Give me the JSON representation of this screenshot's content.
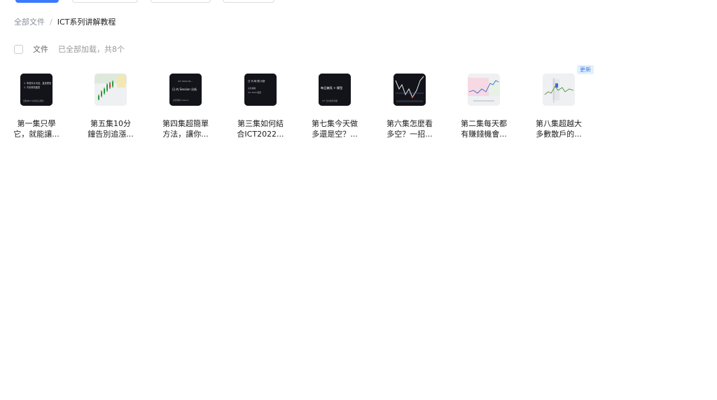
{
  "breadcrumb": {
    "root": "全部文件",
    "separator": "/",
    "current": "ICT系列讲解教程"
  },
  "list_header": {
    "column_label": "文件",
    "status": "已全部加载，共8个"
  },
  "files": [
    {
      "name_line1": "第一集只學",
      "name_line2": "它，就能讓...",
      "thumb_style": "dark-text",
      "thumb_text": [
        "1. 學習本片內容，直接實操",
        "2. 不用再看圖表",
        "掌握本ICT交易核心概念"
      ]
    },
    {
      "name_line1": "第五集10分",
      "name_line2": "鐘告別追漲...",
      "thumb_style": "light-chart"
    },
    {
      "name_line1": "第四集超簡單",
      "name_line2": "方法，讓你...",
      "thumb_style": "dark-text",
      "thumb_text": [
        "ICT 2022 Mo…",
        "日 內 Session 分析",
        "交易時段 Session"
      ]
    },
    {
      "name_line1": "第三集如何結",
      "name_line2": "合ICT2022...",
      "thumb_style": "dark-text",
      "thumb_text": [
        "日 內 時 間 分析",
        "交易策略",
        "ICT 2022 模型"
      ]
    },
    {
      "name_line1": "第七集今天做",
      "name_line2": "多還是空？...",
      "thumb_style": "dark-text",
      "thumb_text": [
        "每日偏見 + 模型",
        "",
        "ICT 日內偏見判斷"
      ]
    },
    {
      "name_line1": "第六集怎麼看",
      "name_line2": "多空？一招...",
      "thumb_style": "dark-chart"
    },
    {
      "name_line1": "第二集每天都",
      "name_line2": "有賺錢機會...",
      "thumb_style": "light-chart-pink"
    },
    {
      "name_line1": "第八集超越大",
      "name_line2": "多數散戶的...",
      "thumb_style": "light-chart-gray",
      "badge": "更新"
    }
  ],
  "colors": {
    "accent": "#3a7afe",
    "badge_bg": "#e3f0fd",
    "badge_text": "#3d7fe0",
    "thumb_dark": "#12141a"
  }
}
